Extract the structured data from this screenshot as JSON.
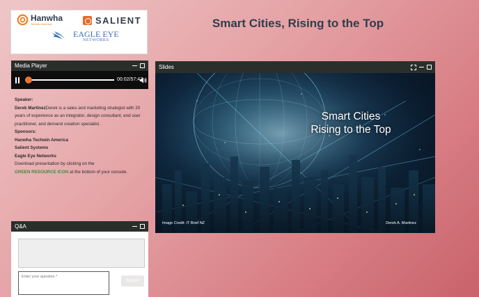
{
  "logos": {
    "hanwha": {
      "name": "Hanwha",
      "subtitle": "Techwin America"
    },
    "salient": {
      "name": "SALIENT"
    },
    "eagle_eye": {
      "name": "EAGLE EYE",
      "subtitle": "NETWORKS"
    }
  },
  "page": {
    "title": "Smart Cities, Rising to the Top"
  },
  "media_player": {
    "title": "Media Player",
    "time": "00:02/57:47",
    "progress": 0.02
  },
  "info": {
    "speaker_heading": "Speaker:",
    "speaker_name": "Derek Martinez",
    "speaker_bio": "Derek is a sales and marketing strategist with 20 years of experience as an integrator, design consultant, end user practitioner, and demand creation specialist.",
    "sponsors_heading": "Sponsors:",
    "sponsors": [
      "Hanwha Techwin America",
      "Salient Systems",
      "Eagle Eye Networks"
    ],
    "download_text_before": "Download presentation by clicking on the",
    "download_highlight": "GREEN RESOURCE ICON",
    "download_text_after": "at the bottom of your console."
  },
  "qa": {
    "title": "Q&A",
    "input_placeholder": "Enter your question *",
    "submit_label": "Submit"
  },
  "slides": {
    "title": "Slides",
    "slide_title_line1": "Smart Cities",
    "slide_title_line2": "Rising to the Top",
    "credit": "Image Credit: IT Brief NZ",
    "author": "Derek A. Martinez"
  },
  "colors": {
    "header_bar": "#2b2f2c",
    "accent_orange": "#e8742c",
    "resource_green": "#3e8b3a",
    "title_text": "#313d4b"
  },
  "icons": [
    "hanwha-logo-icon",
    "salient-logo-icon",
    "eagle-eye-logo-icon",
    "pause-icon",
    "volume-icon",
    "minimize-icon",
    "maximize-icon",
    "expand-icon"
  ]
}
